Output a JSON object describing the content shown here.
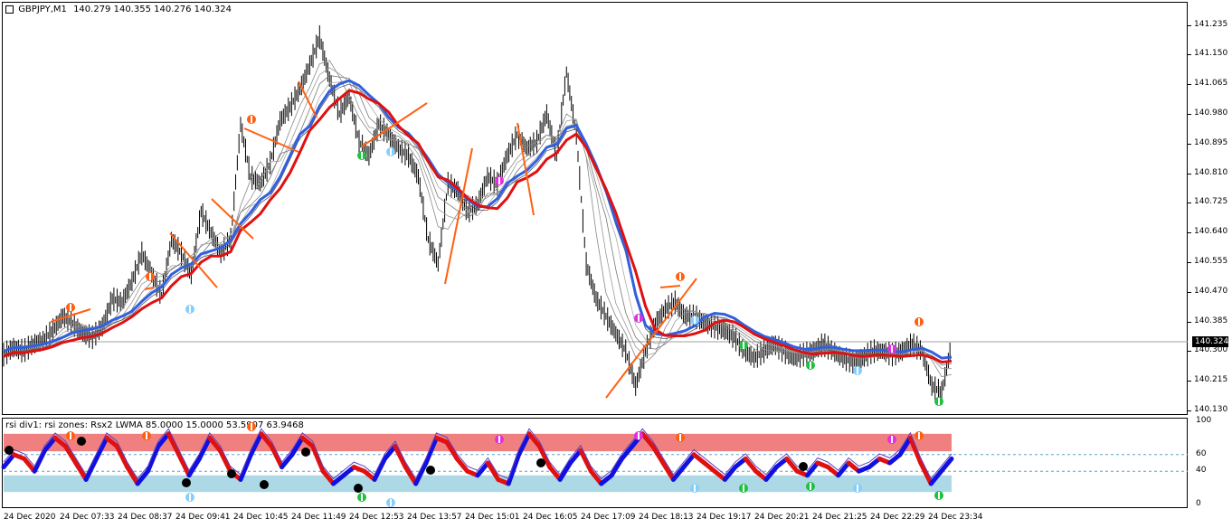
{
  "chart_header": {
    "symbol_label": "GBPJPY,M1",
    "ohlc_label": "140.279 140.355 140.276 140.324",
    "icon": "symbol-icon"
  },
  "indicator_header": {
    "label": "rsi div1: rsi zones: Rsx2 LWMA 85.0000 15.0000 53.5907 63.9468"
  },
  "current_price": "140.324",
  "chart_data": [
    {
      "type": "line",
      "title": "GBPJPY,M1",
      "ylim": [
        140.13,
        141.26
      ],
      "y_ticks": [
        "141.235",
        "141.150",
        "141.065",
        "140.980",
        "140.895",
        "140.810",
        "140.725",
        "140.640",
        "140.555",
        "140.470",
        "140.385",
        "140.300",
        "140.215",
        "140.130"
      ],
      "x_ticks": [
        "24 Dec 2020",
        "24 Dec 07:33",
        "24 Dec 08:37",
        "24 Dec 09:41",
        "24 Dec 10:45",
        "24 Dec 11:49",
        "24 Dec 12:53",
        "24 Dec 13:57",
        "24 Dec 15:01",
        "24 Dec 16:05",
        "24 Dec 17:09",
        "24 Dec 18:13",
        "24 Dec 19:17",
        "24 Dec 20:21",
        "24 Dec 21:25",
        "24 Dec 22:29",
        "24 Dec 23:34"
      ],
      "series": [
        {
          "values": [
            140.29,
            140.31,
            140.3,
            140.32,
            140.33,
            140.36,
            140.4,
            140.38,
            140.35,
            140.34,
            140.37,
            140.45,
            140.44,
            140.5,
            140.58,
            140.52,
            140.46,
            140.62,
            140.58,
            140.52,
            140.7,
            140.64,
            140.58,
            140.62,
            140.95,
            140.8,
            140.78,
            140.84,
            140.96,
            141.0,
            141.05,
            141.12,
            141.2,
            141.08,
            140.98,
            141.03,
            140.9,
            140.86,
            140.95,
            140.92,
            140.88,
            140.86,
            140.8,
            140.62,
            140.55,
            140.78,
            140.76,
            140.7,
            140.72,
            140.8,
            140.78,
            140.86,
            140.92,
            140.88,
            140.9,
            140.98,
            140.86,
            141.1,
            140.92,
            140.55,
            140.45,
            140.4,
            140.35,
            140.3,
            140.2,
            140.3,
            140.38,
            140.42,
            140.44,
            140.4,
            140.4,
            140.38,
            140.37,
            140.36,
            140.34,
            140.3,
            140.28,
            140.3,
            140.32,
            140.3,
            140.28,
            140.29,
            140.3,
            140.32,
            140.3,
            140.28,
            140.27,
            140.28,
            140.3,
            140.3,
            140.29,
            140.3,
            140.32,
            140.3,
            140.2,
            140.18,
            140.32
          ]
        }
      ]
    },
    {
      "type": "line",
      "title": "rsi div1: rsi zones: Rsx2 LWMA 85.0000 15.0000 53.5907 63.9468",
      "ylim": [
        0,
        100
      ],
      "y_ticks": [
        "100",
        "60",
        "40",
        "0"
      ],
      "zones": [
        {
          "from": 85,
          "to": 63.9468
        },
        {
          "from": 15,
          "to": 35
        }
      ],
      "levels": [
        60,
        40
      ],
      "series": [
        {
          "values": [
            45,
            60,
            55,
            40,
            65,
            80,
            70,
            50,
            30,
            55,
            80,
            70,
            45,
            25,
            40,
            70,
            85,
            60,
            35,
            55,
            80,
            65,
            40,
            30,
            60,
            85,
            70,
            45,
            60,
            80,
            70,
            40,
            25,
            35,
            45,
            40,
            30,
            55,
            70,
            45,
            25,
            50,
            80,
            75,
            55,
            40,
            35,
            50,
            30,
            25,
            60,
            85,
            70,
            45,
            30,
            50,
            65,
            40,
            25,
            35,
            55,
            70,
            85,
            70,
            50,
            30,
            45,
            60,
            50,
            40,
            30,
            45,
            55,
            40,
            30,
            45,
            55,
            40,
            35,
            50,
            45,
            35,
            50,
            40,
            45,
            55,
            50,
            60,
            80,
            50,
            25,
            40,
            55
          ]
        }
      ]
    }
  ]
}
